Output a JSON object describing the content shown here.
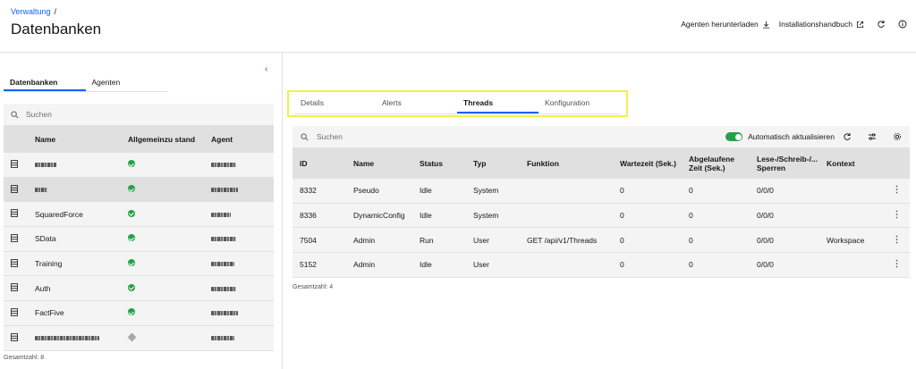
{
  "header": {
    "breadcrumb": "Verwaltung",
    "breadcrumb_sep": "/",
    "title": "Datenbanken",
    "download_agents": "Agenten herunterladen",
    "install_manual": "Installationshandbuch"
  },
  "left": {
    "tabs": [
      "Datenbanken",
      "Agenten"
    ],
    "search_placeholder": "Suchen",
    "columns": [
      "Name",
      "Allgemeinzu stand",
      "Agent"
    ],
    "rows": [
      {
        "name": "",
        "status": "ok",
        "agent": ""
      },
      {
        "name": "",
        "status": "ok",
        "agent": ""
      },
      {
        "name": "SquaredForce",
        "status": "ok",
        "agent": ""
      },
      {
        "name": "SData",
        "status": "ok",
        "agent": ""
      },
      {
        "name": "Training",
        "status": "ok",
        "agent": ""
      },
      {
        "name": "Auth",
        "status": "ok",
        "agent": ""
      },
      {
        "name": "FactFive",
        "status": "ok",
        "agent": ""
      },
      {
        "name": "",
        "status": "unknown",
        "agent": ""
      }
    ],
    "total": "Gesamtzahl: 8"
  },
  "right": {
    "tabs": [
      "Details",
      "Alerts",
      "Threads",
      "Konfiguration"
    ],
    "active_tab": "Threads",
    "search_placeholder": "Suchen",
    "auto_refresh_label": "Automatisch aktualisieren",
    "columns": [
      "ID",
      "Name",
      "Status",
      "Typ",
      "Funktion",
      "Wartezeit (Sek.)",
      "Abgelaufene Zeit (Sek.)",
      "Lese-/Schreib-/... Sperren",
      "Kontext"
    ],
    "rows": [
      [
        "8332",
        "Pseudo",
        "Idle",
        "System",
        "",
        "0",
        "0",
        "0/0/0",
        ""
      ],
      [
        "8336",
        "DynamicConfig",
        "Idle",
        "System",
        "",
        "0",
        "0",
        "0/0/0",
        ""
      ],
      [
        "7504",
        "Admin",
        "Run",
        "User",
        "GET /api/v1/Threads",
        "0",
        "0",
        "0/0/0",
        "Workspace"
      ],
      [
        "5152",
        "Admin",
        "Idle",
        "User",
        "",
        "0",
        "0",
        "0/0/0",
        ""
      ]
    ],
    "total": "Gesamtzahl: 4"
  },
  "colors": {
    "accent": "#0f62fe",
    "success": "#24a148",
    "highlight": "#f1f14a"
  }
}
